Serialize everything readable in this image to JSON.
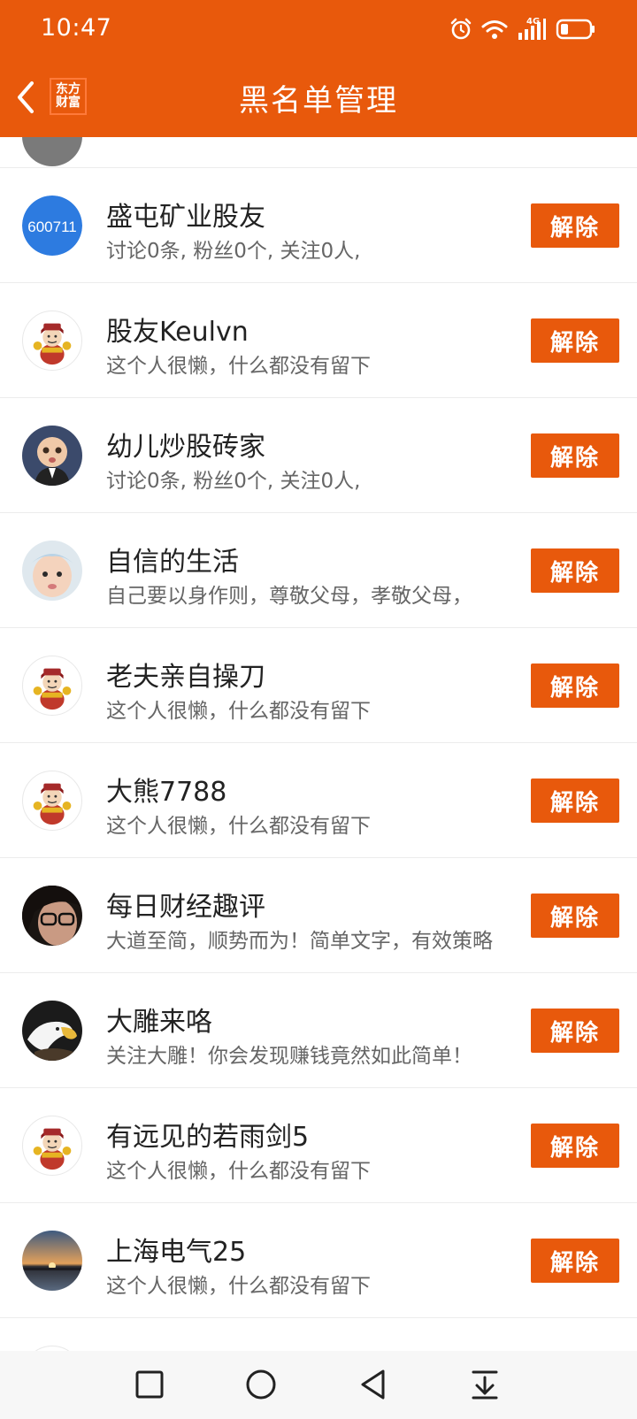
{
  "status_bar": {
    "time": "10:47",
    "network": "4G"
  },
  "header": {
    "title": "黑名单管理",
    "logo_line1": "东方",
    "logo_line2": "财富"
  },
  "list": {
    "items": [
      {
        "name": "盛屯矿业股友",
        "bio": "讨论0条, 粉丝0个, 关注0人,",
        "avatar": "stock-code",
        "avatar_text": "600711",
        "action": "解除"
      },
      {
        "name": "股友Keulvn",
        "bio": "这个人很懒，什么都没有留下",
        "avatar": "default-mascot",
        "action": "解除"
      },
      {
        "name": "幼儿炒股砖家",
        "bio": "讨论0条, 粉丝0个, 关注0人,",
        "avatar": "baby-boss",
        "action": "解除"
      },
      {
        "name": "自信的生活",
        "bio": "自己要以身作则，尊敬父母，孝敬父母，",
        "avatar": "baby-photo",
        "action": "解除"
      },
      {
        "name": "老夫亲自操刀",
        "bio": "这个人很懒，什么都没有留下",
        "avatar": "default-mascot",
        "action": "解除"
      },
      {
        "name": "大熊7788",
        "bio": "这个人很懒，什么都没有留下",
        "avatar": "default-mascot",
        "action": "解除"
      },
      {
        "name": "每日财经趣评",
        "bio": "大道至简，顺势而为！简单文字，有效策略",
        "avatar": "glasses-girl",
        "action": "解除"
      },
      {
        "name": "大雕来咯",
        "bio": "关注大雕！你会发现赚钱竟然如此简单！",
        "avatar": "eagle",
        "action": "解除"
      },
      {
        "name": "有远见的若雨剑5",
        "bio": "这个人很懒，什么都没有留下",
        "avatar": "default-mascot",
        "action": "解除"
      },
      {
        "name": "上海电气25",
        "bio": "这个人很懒，什么都没有留下",
        "avatar": "sunset",
        "action": "解除"
      }
    ]
  },
  "colors": {
    "accent": "#E8590C",
    "divider": "#ececec",
    "name_text": "#222222",
    "bio_text": "#666666"
  },
  "nav": {
    "icons": [
      "recent-apps-icon",
      "home-icon",
      "back-icon",
      "notification-pull-icon"
    ]
  }
}
